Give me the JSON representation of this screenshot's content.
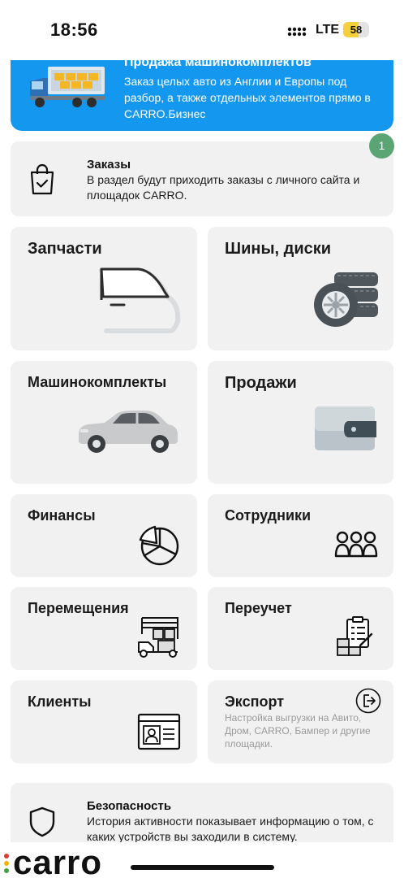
{
  "status_bar": {
    "time": "18:56",
    "network": "LTE",
    "battery": "58",
    "battery_fraction": 0.58
  },
  "banner": {
    "title": "Продажа машинокомплектов",
    "text": "Заказ целых авто из Англии и Европы под разбор, а также отдельных элементов прямо в CARRO.Бизнес",
    "art_icon": "truck-icon",
    "color": "#1497ef"
  },
  "notification_count": "1",
  "orders": {
    "title": "Заказы",
    "text": "В раздел будут приходить заказы с личного сайта и площадок CARRO.",
    "icon": "shopping-bag-icon"
  },
  "tiles": {
    "parts": {
      "title": "Запчасти",
      "icon": "car-door-icon"
    },
    "tires": {
      "title": "Шины, диски",
      "icon": "tires-icon"
    },
    "car_kits": {
      "title": "Машинокомплекты",
      "icon": "car-icon"
    },
    "sales": {
      "title": "Продажи",
      "icon": "wallet-icon"
    },
    "finance": {
      "title": "Финансы",
      "icon": "pie-chart-icon"
    },
    "staff": {
      "title": "Сотрудники",
      "icon": "people-icon"
    },
    "transfers": {
      "title": "Перемещения",
      "icon": "warehouse-truck-icon"
    },
    "recount": {
      "title": "Переучет",
      "icon": "inventory-clipboard-icon"
    },
    "clients": {
      "title": "Клиенты",
      "icon": "id-card-icon"
    },
    "export": {
      "title": "Экспорт",
      "subtitle": "Настройка выгрузки на Авито, Дром, CARRO, Бампер и другие площадки.",
      "icon": "export-icon"
    }
  },
  "security": {
    "title": "Безопасность",
    "text": "История активности показывает информацию о том, с каких устройств вы заходили в систему.",
    "icon": "shield-icon"
  },
  "logo": {
    "text": "carro",
    "dot_colors": [
      "#e53935",
      "#f6b400",
      "#43a047"
    ]
  }
}
